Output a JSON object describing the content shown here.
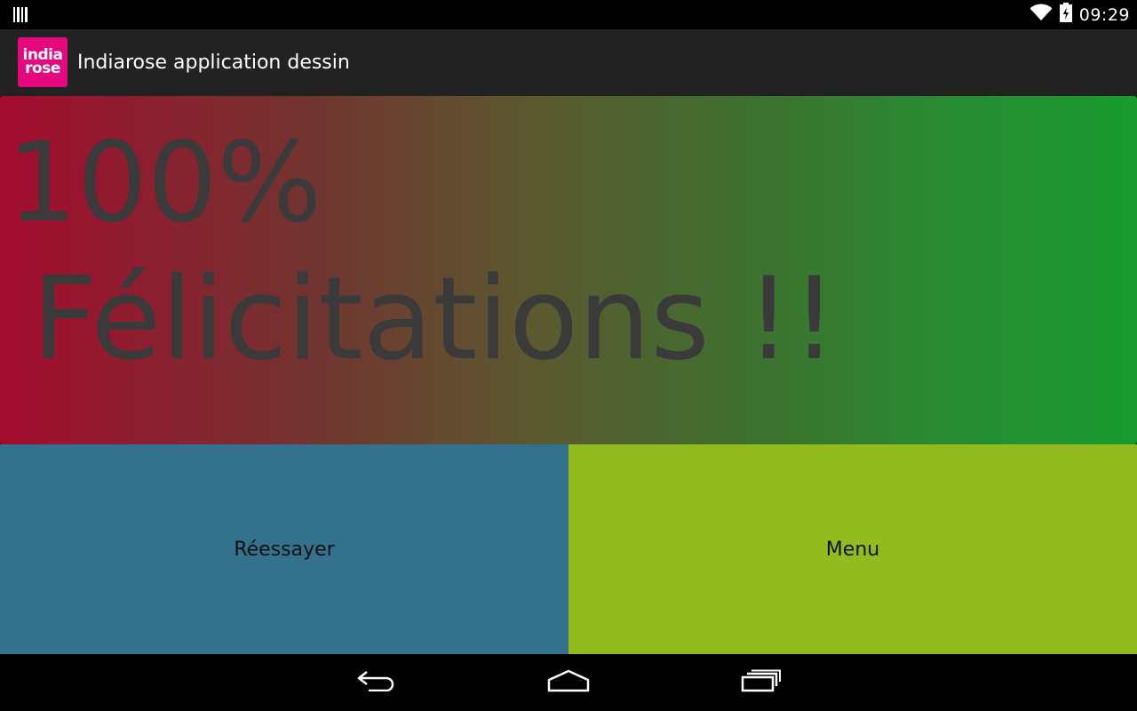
{
  "status_bar": {
    "time": "09:29",
    "left_icon": "barcode-icon",
    "wifi_icon": "wifi-icon",
    "battery_icon": "battery-charging-icon"
  },
  "action_bar": {
    "logo_line1": "india",
    "logo_line2": "rose",
    "title": "Indiarose application dessin"
  },
  "result": {
    "score": "100%",
    "message": "Félicitations !!",
    "gradient_start": "#a40c2f",
    "gradient_end": "#189a30",
    "text_color": "#3a3a3a"
  },
  "buttons": {
    "retry_label": "Réessayer",
    "retry_color": "#33718c",
    "menu_label": "Menu",
    "menu_color": "#92bb1f"
  },
  "nav_bar": {
    "back_icon": "back-icon",
    "home_icon": "home-icon",
    "recents_icon": "recents-icon"
  }
}
